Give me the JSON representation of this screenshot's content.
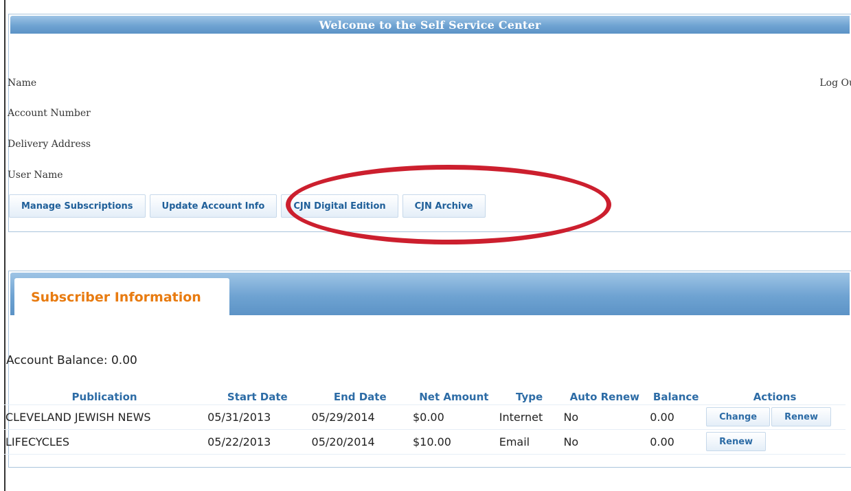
{
  "welcome": {
    "title": "Welcome to the Self Service Center"
  },
  "account_info": {
    "name_label": "Name",
    "account_number_label": "Account Number",
    "delivery_address_label": "Delivery Address",
    "user_name_label": "User Name",
    "logout_label": "Log Ou"
  },
  "nav_buttons": {
    "manage_subscriptions": "Manage Subscriptions",
    "update_account_info": "Update Account Info",
    "cjn_digital_edition": "CJN Digital Edition",
    "cjn_archive": "CJN Archive"
  },
  "annotation": {
    "oval_color": "#cc1f2e"
  },
  "subscriber": {
    "tab_label": "Subscriber Information",
    "account_balance": "Account Balance: 0.00",
    "columns": [
      "Publication",
      "Start Date",
      "End Date",
      "Net Amount",
      "Type",
      "Auto Renew",
      "Balance",
      "Actions"
    ],
    "rows": [
      {
        "publication": "CLEVELAND JEWISH NEWS",
        "start_date": "05/31/2013",
        "end_date": "05/29/2014",
        "net_amount": "$0.00",
        "type": "Internet",
        "auto_renew": "No",
        "balance": "0.00",
        "actions": [
          "Change",
          "Renew"
        ]
      },
      {
        "publication": "LIFECYCLES",
        "start_date": "05/22/2013",
        "end_date": "05/20/2014",
        "net_amount": "$10.00",
        "type": "Email",
        "auto_renew": "No",
        "balance": "0.00",
        "actions": [
          "Renew"
        ]
      }
    ]
  },
  "colors": {
    "header_blue": "#6fa3d2",
    "tab_text_orange": "#e87b10",
    "link_blue": "#1f5f99"
  }
}
